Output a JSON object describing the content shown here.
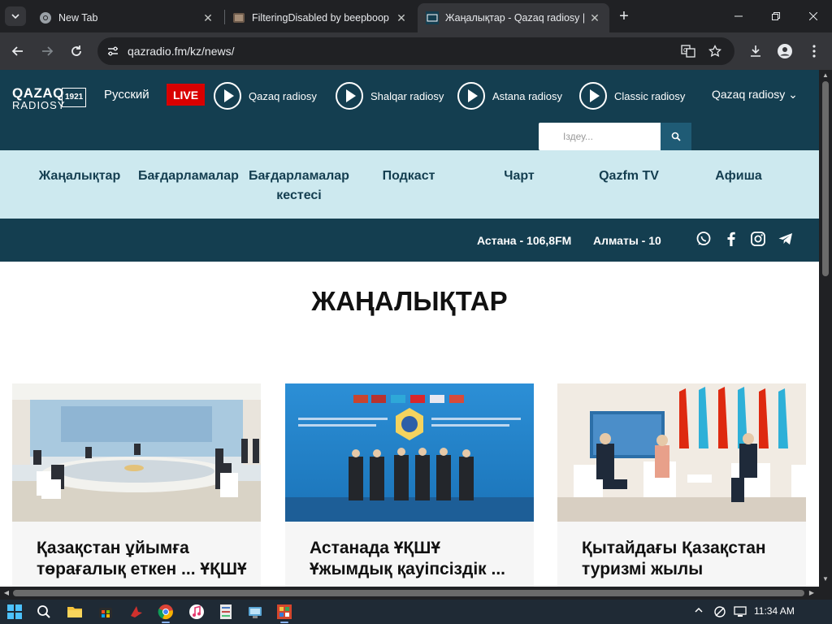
{
  "browser": {
    "tabs": [
      {
        "title": "New Tab",
        "icon": "chrome-icon"
      },
      {
        "title": "FilteringDisabled by beepboop",
        "icon": "image-favicon"
      },
      {
        "title": "Жаңалықтар - Qazaq radiosy |",
        "icon": "qr-1921-favicon"
      }
    ],
    "url": "qazradio.fm/kz/news/"
  },
  "site": {
    "logo": {
      "line1": "QAZAQ",
      "line2": "RADIOSY",
      "year": "1921"
    },
    "language": "Русский",
    "live": "LIVE",
    "stations": [
      "Qazaq radiosy",
      "Shalqar radiosy",
      "Astana radiosy",
      "Classic radiosy"
    ],
    "dropdown": "Qazaq radiosy",
    "search_placeholder": "Іздеу...",
    "nav": [
      "Жаңалықтар",
      "Бағдарламалар",
      "Бағдарламалар кестесі",
      "Подкаст",
      "Чарт",
      "Qazfm TV",
      "Афиша"
    ],
    "frequencies": [
      "Астана - 106,8FM",
      "Алматы - 10"
    ],
    "social": [
      "whatsapp-icon",
      "facebook-icon",
      "instagram-icon",
      "telegram-icon"
    ],
    "colors": {
      "header": "#143e50",
      "nav_bg": "#cde9ef",
      "live": "#d90000"
    }
  },
  "page": {
    "title": "ЖАҢАЛЫҚТАР",
    "cards": [
      {
        "headline": "Қазақстан ұйымға төрағалық еткен ... ҰҚШҰ"
      },
      {
        "headline": "Астанада ҰҚШҰ Ұжымдық қауіпсіздік ..."
      },
      {
        "headline": "Қытайдағы Қазақстан туризмі жылы"
      }
    ]
  },
  "taskbar": {
    "time": "11:34 AM"
  }
}
